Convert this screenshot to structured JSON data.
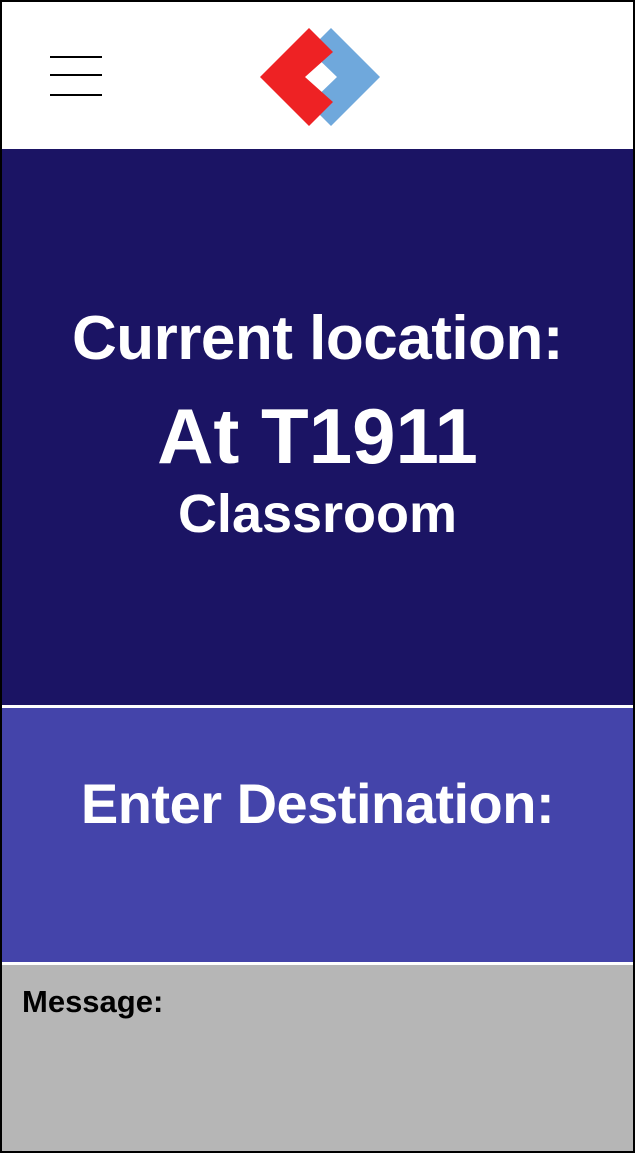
{
  "header": {
    "menu_icon": "hamburger-menu-icon",
    "logo_icon": "interlocking-diamonds-logo"
  },
  "current_location": {
    "label": "Current location:",
    "value": "At T1911",
    "detail": "Classroom"
  },
  "destination": {
    "label": "Enter Destination:"
  },
  "message": {
    "label": "Message:"
  },
  "colors": {
    "current_bg": "#1b1464",
    "destination_bg": "#4444aa",
    "message_bg": "#b6b6b6",
    "logo_red": "#ee2224",
    "logo_blue": "#6fa8dc",
    "text_light": "#ffffff"
  }
}
